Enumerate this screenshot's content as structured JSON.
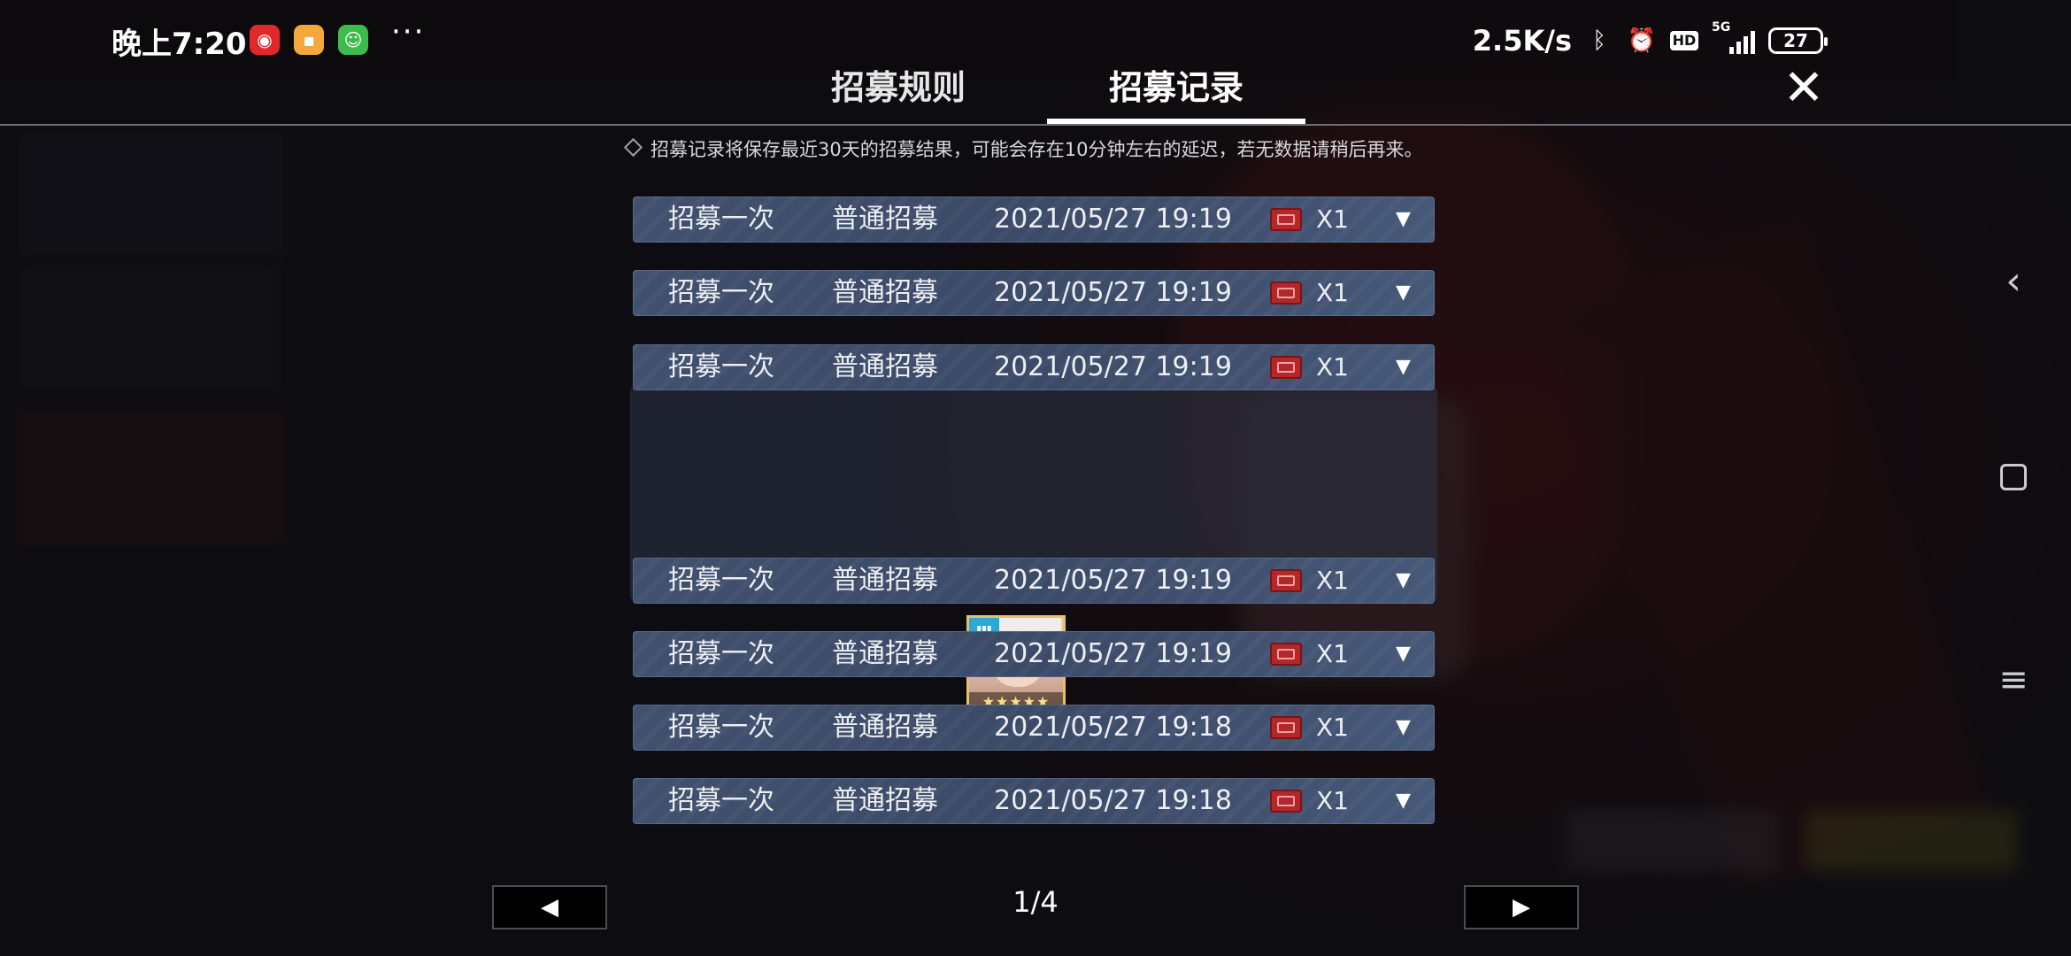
{
  "status_bar": {
    "time": "晚上7:20",
    "more": "···",
    "net_speed": "2.5K/s",
    "network": "5G",
    "hd": "HD",
    "battery": "27"
  },
  "tabs": {
    "rules": "招募规则",
    "records": "招募记录",
    "active": "records"
  },
  "notice": "招募记录将保存最近30天的招募结果，可能会存在10分钟左右的延迟，若无数据请稍后再来。",
  "records": [
    {
      "type": "招募一次",
      "pool": "普通招募",
      "time": "2021/05/27 19:19",
      "count": "X1",
      "expanded": false
    },
    {
      "type": "招募一次",
      "pool": "普通招募",
      "time": "2021/05/27 19:19",
      "count": "X1",
      "expanded": false
    },
    {
      "type": "招募一次",
      "pool": "普通招募",
      "time": "2021/05/27 19:19",
      "count": "X1",
      "expanded": true
    },
    {
      "type": "招募一次",
      "pool": "普通招募",
      "time": "2021/05/27 19:19",
      "count": "X1",
      "expanded": false
    },
    {
      "type": "招募一次",
      "pool": "普通招募",
      "time": "2021/05/27 19:19",
      "count": "X1",
      "expanded": false
    },
    {
      "type": "招募一次",
      "pool": "普通招募",
      "time": "2021/05/27 19:18",
      "count": "X1",
      "expanded": false
    },
    {
      "type": "招募一次",
      "pool": "普通招募",
      "time": "2021/05/27 19:18",
      "count": "X1",
      "expanded": false
    }
  ],
  "operator_result": {
    "rarity_stars": 5,
    "class_icon": "caster-class-icon"
  },
  "pager": {
    "current_page": 1,
    "total_pages": 4,
    "label": "1/4"
  },
  "colors": {
    "row_bg": "#40506e",
    "accent_underline": "#ffffff",
    "ticket": "#b2272a",
    "rarity_frame": "#e7c06a"
  }
}
